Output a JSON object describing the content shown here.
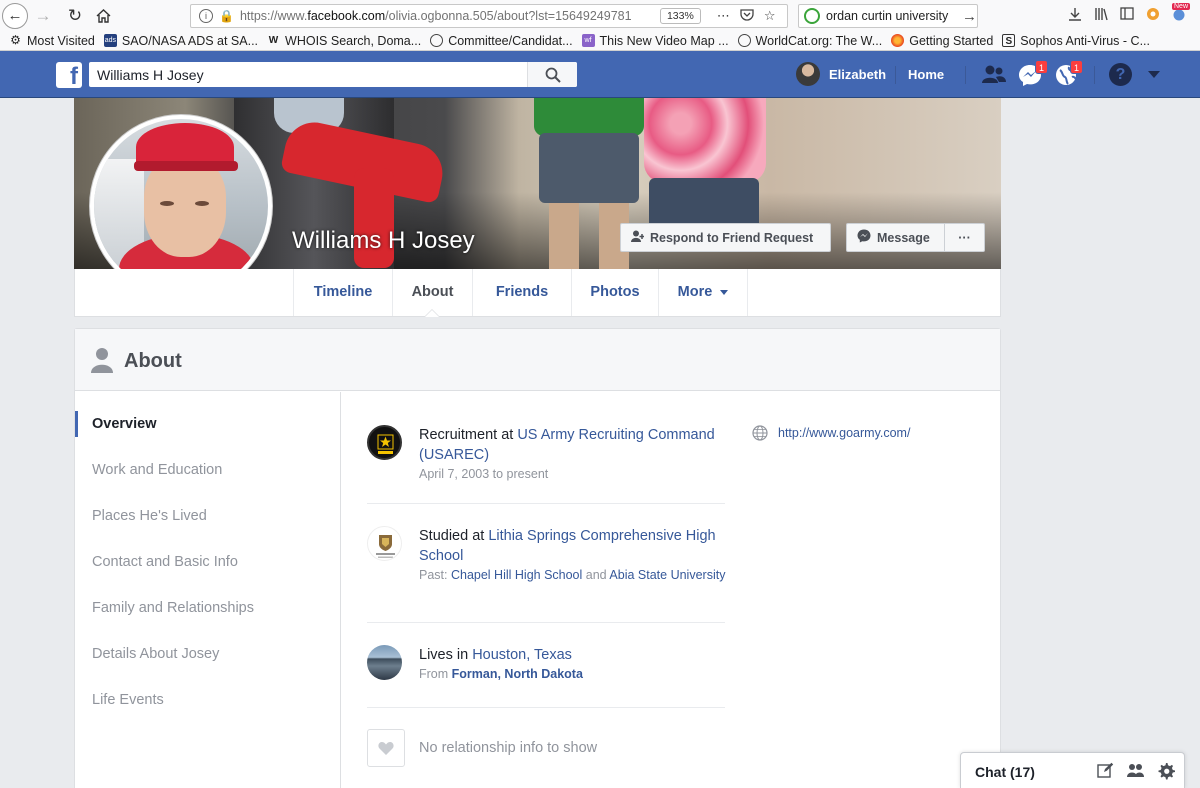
{
  "browser": {
    "url_prefix": "https://www.",
    "url_domain": "facebook.com",
    "url_path": "/olivia.ogbonna.505/about?lst=15649249781",
    "zoom": "133%",
    "search_query": "ordan curtin university",
    "new_badge": "New",
    "bookmarks": [
      "Most Visited",
      "SAO/NASA ADS at SA...",
      "WHOIS Search, Doma...",
      "Committee/Candidat...",
      "This New Video Map ...",
      "WorldCat.org: The W...",
      "Getting Started",
      "Sophos Anti-Virus - C..."
    ]
  },
  "fb": {
    "logo": "f",
    "search_value": "Williams H Josey",
    "user_name": "Elizabeth",
    "home_label": "Home",
    "messages_badge": "1",
    "notifications_badge": "1",
    "help": "?",
    "accent": "#4267b2"
  },
  "profile": {
    "name": "Williams H Josey",
    "respond_btn": "Respond to Friend Request",
    "message_btn": "Message",
    "more_btn": "···",
    "tabs": [
      "Timeline",
      "About",
      "Friends",
      "Photos",
      "More"
    ]
  },
  "about": {
    "title": "About",
    "sidebar": [
      "Overview",
      "Work and Education",
      "Places He's Lived",
      "Contact and Basic Info",
      "Family and Relationships",
      "Details About Josey",
      "Life Events"
    ],
    "work": {
      "prefix": "Recruitment at ",
      "org": "US Army Recruiting Command (USAREC)",
      "dates": "April 7, 2003 to present"
    },
    "education": {
      "prefix": "Studied at ",
      "school": "Lithia Springs Comprehensive High School",
      "past_label": "Past: ",
      "past_1": "Chapel Hill High School",
      "and": " and ",
      "past_2": "Abia State University"
    },
    "lives": {
      "prefix": "Lives in ",
      "city": "Houston, Texas",
      "from_label": "From ",
      "from_city": "Forman, North Dakota"
    },
    "relationship": "No relationship info to show",
    "website": "http://www.goarmy.com/"
  },
  "chat": {
    "label": "Chat (17)"
  }
}
